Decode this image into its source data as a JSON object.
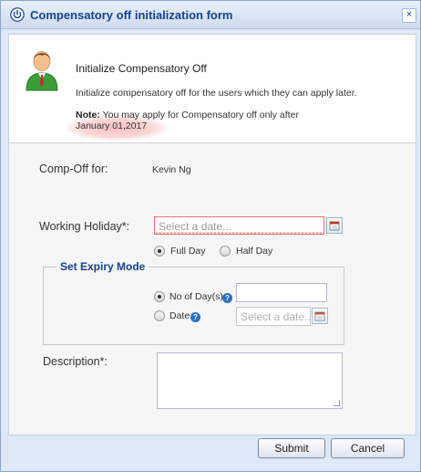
{
  "window": {
    "title": "Compensatory off initialization form",
    "close_glyph": "×"
  },
  "header": {
    "title": "Initialize Compensatory Off",
    "description": "Initialize compensatory off for the users which they can apply later.",
    "note_label": "Note:",
    "note_text": " You may apply for Compensatory off only after",
    "note_date": "January 01,2017"
  },
  "form": {
    "compoff_for_label": "Comp-Off for:",
    "compoff_for_value": "Kevin Ng",
    "working_holiday_label": "Working Holiday*:",
    "working_holiday_placeholder": "Select a date...",
    "day_options": {
      "full_day": "Full Day",
      "half_day": "Half Day",
      "selected": "Full Day"
    },
    "expiry": {
      "legend": "Set Expiry Mode",
      "no_of_days_label": "No of Day(s)",
      "date_label": "Date",
      "date_placeholder": "Select a date...",
      "selected": "No of Day(s)"
    },
    "description_label": "Description*:"
  },
  "buttons": {
    "submit": "Submit",
    "cancel": "Cancel"
  },
  "icons": {
    "title": "power-icon",
    "close": "close-icon",
    "avatar": "user-avatar-icon",
    "calendar": "calendar-icon",
    "help": "help-icon"
  },
  "colors": {
    "title_text": "#15428b",
    "legend_text": "#15428b",
    "error_border": "#e57373",
    "help_icon": "#2b6fc2",
    "note_highlight": "#f58c8c"
  }
}
